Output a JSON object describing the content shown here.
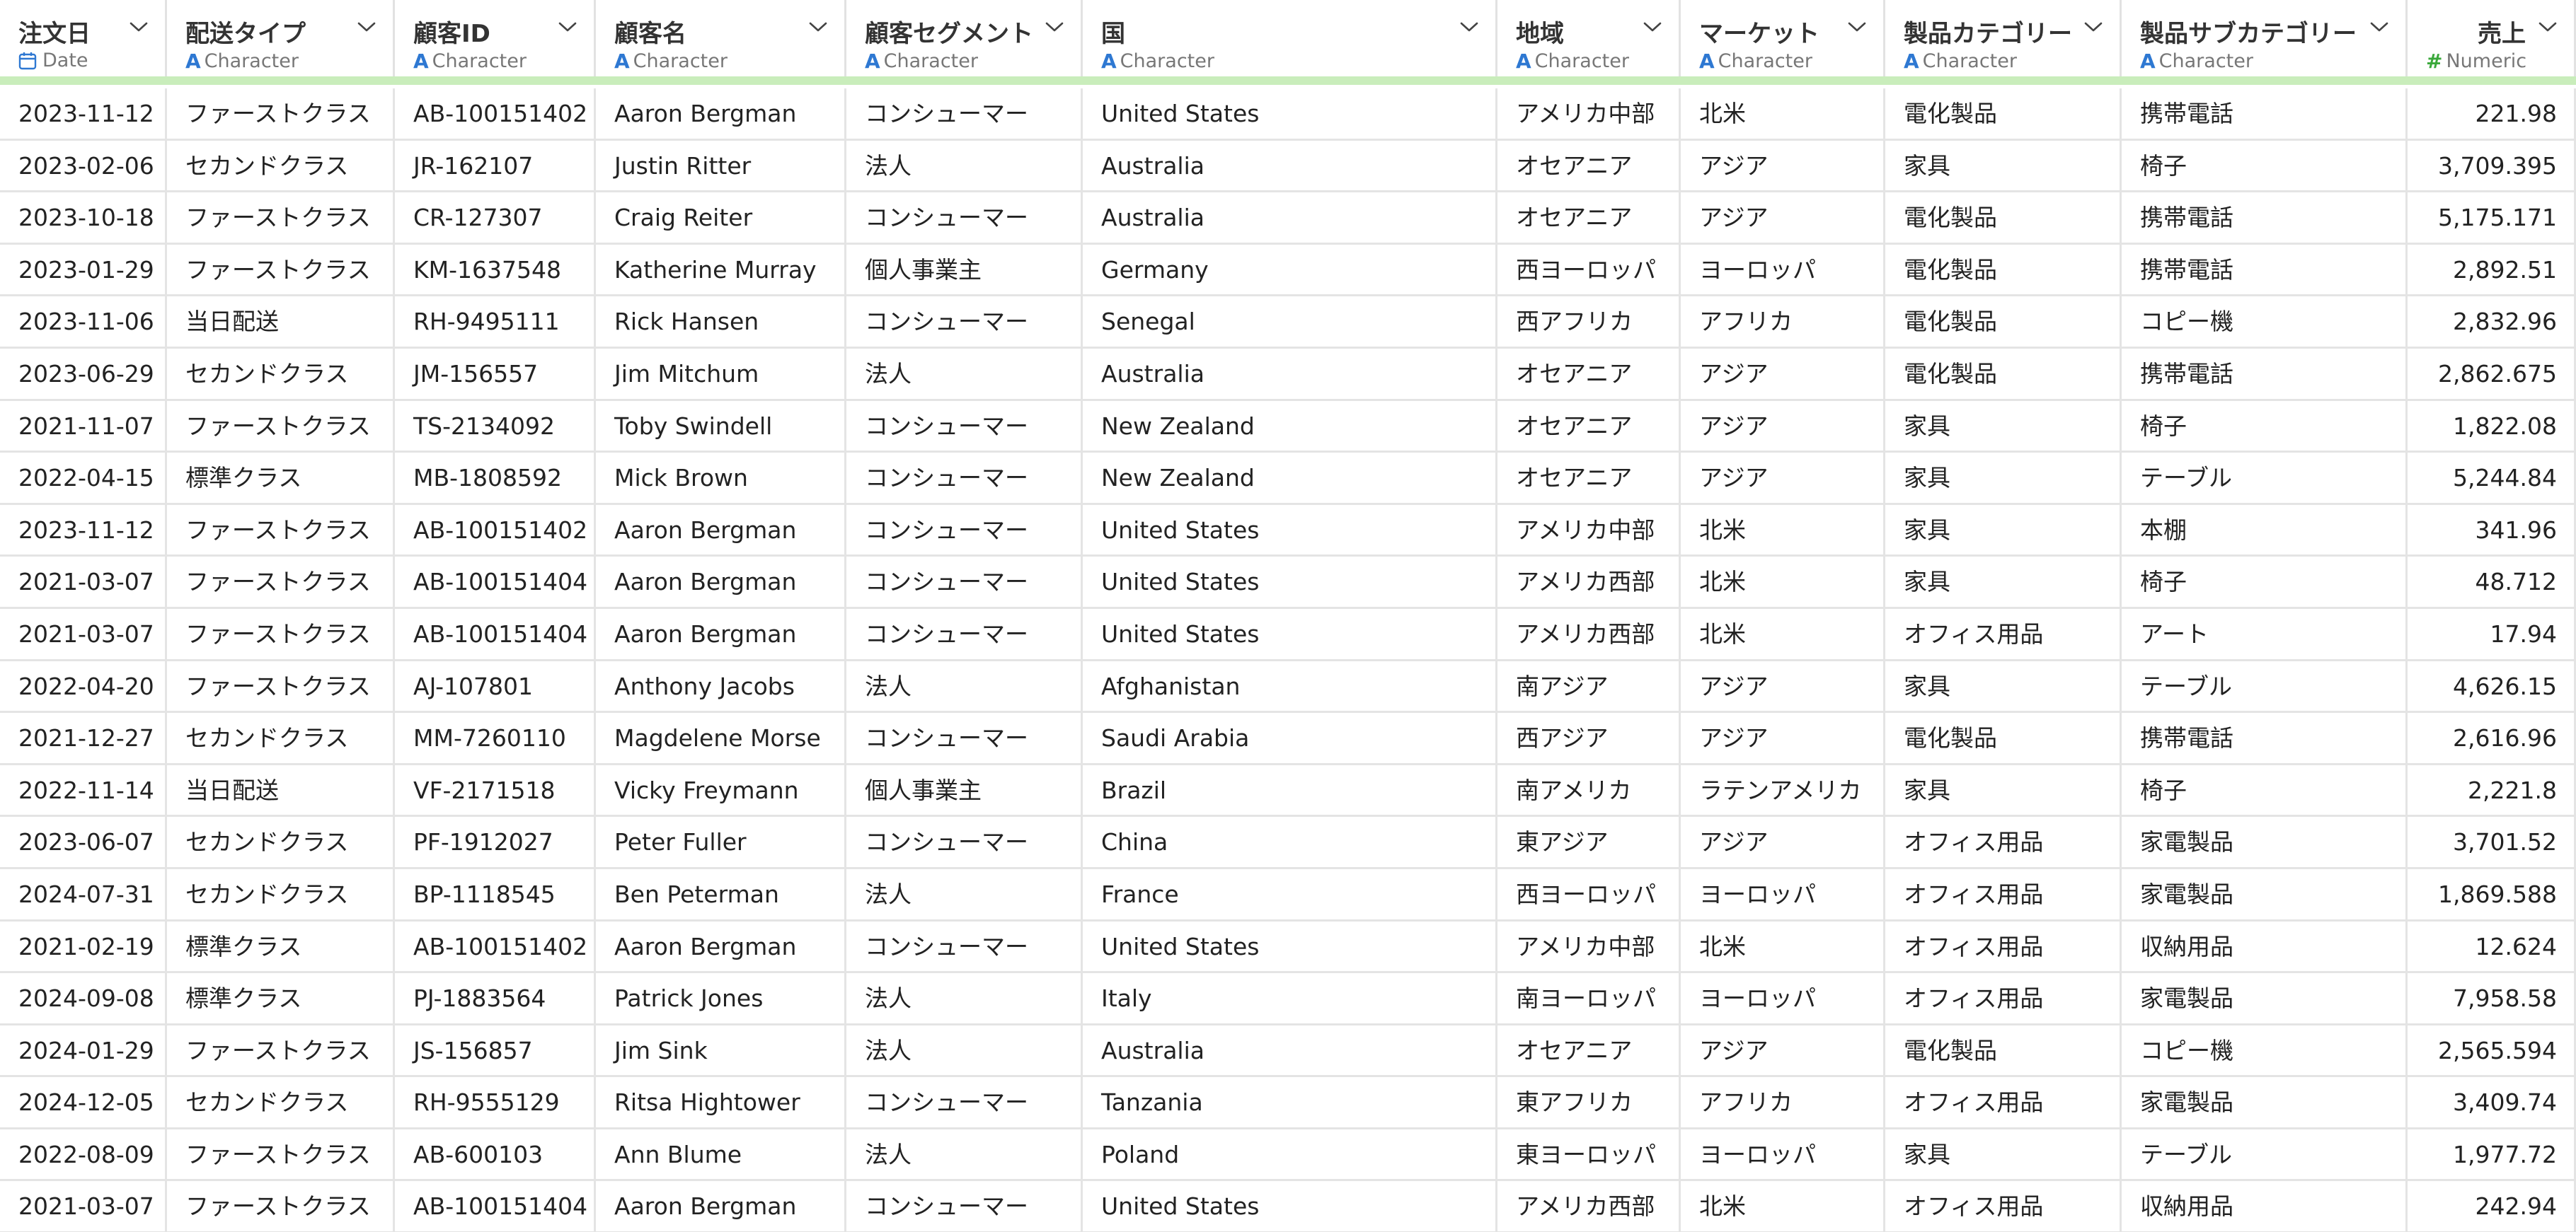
{
  "columns": [
    {
      "name": "注文日",
      "type": "Date",
      "type_icon": "calendar-icon",
      "align": "left"
    },
    {
      "name": "配送タイプ",
      "type": "Character",
      "type_icon": "character-icon",
      "align": "left"
    },
    {
      "name": "顧客ID",
      "type": "Character",
      "type_icon": "character-icon",
      "align": "left"
    },
    {
      "name": "顧客名",
      "type": "Character",
      "type_icon": "character-icon",
      "align": "left"
    },
    {
      "name": "顧客セグメント",
      "type": "Character",
      "type_icon": "character-icon",
      "align": "left"
    },
    {
      "name": "国",
      "type": "Character",
      "type_icon": "character-icon",
      "align": "left"
    },
    {
      "name": "地域",
      "type": "Character",
      "type_icon": "character-icon",
      "align": "left"
    },
    {
      "name": "マーケット",
      "type": "Character",
      "type_icon": "character-icon",
      "align": "left"
    },
    {
      "name": "製品カテゴリー",
      "type": "Character",
      "type_icon": "character-icon",
      "align": "left"
    },
    {
      "name": "製品サブカテゴリー",
      "type": "Character",
      "type_icon": "character-icon",
      "align": "left"
    },
    {
      "name": "売上",
      "type": "Numeric",
      "type_icon": "numeric-icon",
      "align": "right"
    }
  ],
  "type_icon_glyphs": {
    "character": "A",
    "numeric": "#"
  },
  "colors": {
    "character": "#2e78d2",
    "numeric": "#39a83a",
    "date": "#2e78d2",
    "header_bar": "#c9edbb"
  },
  "rows": [
    [
      "2023-11-12",
      "ファーストクラス",
      "AB-100151402",
      "Aaron Bergman",
      "コンシューマー",
      "United States",
      "アメリカ中部",
      "北米",
      "電化製品",
      "携帯電話",
      "221.98"
    ],
    [
      "2023-02-06",
      "セカンドクラス",
      "JR-162107",
      "Justin Ritter",
      "法人",
      "Australia",
      "オセアニア",
      "アジア",
      "家具",
      "椅子",
      "3,709.395"
    ],
    [
      "2023-10-18",
      "ファーストクラス",
      "CR-127307",
      "Craig Reiter",
      "コンシューマー",
      "Australia",
      "オセアニア",
      "アジア",
      "電化製品",
      "携帯電話",
      "5,175.171"
    ],
    [
      "2023-01-29",
      "ファーストクラス",
      "KM-1637548",
      "Katherine Murray",
      "個人事業主",
      "Germany",
      "西ヨーロッパ",
      "ヨーロッパ",
      "電化製品",
      "携帯電話",
      "2,892.51"
    ],
    [
      "2023-11-06",
      "当日配送",
      "RH-9495111",
      "Rick Hansen",
      "コンシューマー",
      "Senegal",
      "西アフリカ",
      "アフリカ",
      "電化製品",
      "コピー機",
      "2,832.96"
    ],
    [
      "2023-06-29",
      "セカンドクラス",
      "JM-156557",
      "Jim Mitchum",
      "法人",
      "Australia",
      "オセアニア",
      "アジア",
      "電化製品",
      "携帯電話",
      "2,862.675"
    ],
    [
      "2021-11-07",
      "ファーストクラス",
      "TS-2134092",
      "Toby Swindell",
      "コンシューマー",
      "New Zealand",
      "オセアニア",
      "アジア",
      "家具",
      "椅子",
      "1,822.08"
    ],
    [
      "2022-04-15",
      "標準クラス",
      "MB-1808592",
      "Mick Brown",
      "コンシューマー",
      "New Zealand",
      "オセアニア",
      "アジア",
      "家具",
      "テーブル",
      "5,244.84"
    ],
    [
      "2023-11-12",
      "ファーストクラス",
      "AB-100151402",
      "Aaron Bergman",
      "コンシューマー",
      "United States",
      "アメリカ中部",
      "北米",
      "家具",
      "本棚",
      "341.96"
    ],
    [
      "2021-03-07",
      "ファーストクラス",
      "AB-100151404",
      "Aaron Bergman",
      "コンシューマー",
      "United States",
      "アメリカ西部",
      "北米",
      "家具",
      "椅子",
      "48.712"
    ],
    [
      "2021-03-07",
      "ファーストクラス",
      "AB-100151404",
      "Aaron Bergman",
      "コンシューマー",
      "United States",
      "アメリカ西部",
      "北米",
      "オフィス用品",
      "アート",
      "17.94"
    ],
    [
      "2022-04-20",
      "ファーストクラス",
      "AJ-107801",
      "Anthony Jacobs",
      "法人",
      "Afghanistan",
      "南アジア",
      "アジア",
      "家具",
      "テーブル",
      "4,626.15"
    ],
    [
      "2021-12-27",
      "セカンドクラス",
      "MM-7260110",
      "Magdelene Morse",
      "コンシューマー",
      "Saudi Arabia",
      "西アジア",
      "アジア",
      "電化製品",
      "携帯電話",
      "2,616.96"
    ],
    [
      "2022-11-14",
      "当日配送",
      "VF-2171518",
      "Vicky Freymann",
      "個人事業主",
      "Brazil",
      "南アメリカ",
      "ラテンアメリカ",
      "家具",
      "椅子",
      "2,221.8"
    ],
    [
      "2023-06-07",
      "セカンドクラス",
      "PF-1912027",
      "Peter Fuller",
      "コンシューマー",
      "China",
      "東アジア",
      "アジア",
      "オフィス用品",
      "家電製品",
      "3,701.52"
    ],
    [
      "2024-07-31",
      "セカンドクラス",
      "BP-1118545",
      "Ben Peterman",
      "法人",
      "France",
      "西ヨーロッパ",
      "ヨーロッパ",
      "オフィス用品",
      "家電製品",
      "1,869.588"
    ],
    [
      "2021-02-19",
      "標準クラス",
      "AB-100151402",
      "Aaron Bergman",
      "コンシューマー",
      "United States",
      "アメリカ中部",
      "北米",
      "オフィス用品",
      "収納用品",
      "12.624"
    ],
    [
      "2024-09-08",
      "標準クラス",
      "PJ-1883564",
      "Patrick Jones",
      "法人",
      "Italy",
      "南ヨーロッパ",
      "ヨーロッパ",
      "オフィス用品",
      "家電製品",
      "7,958.58"
    ],
    [
      "2024-01-29",
      "ファーストクラス",
      "JS-156857",
      "Jim Sink",
      "法人",
      "Australia",
      "オセアニア",
      "アジア",
      "電化製品",
      "コピー機",
      "2,565.594"
    ],
    [
      "2024-12-05",
      "セカンドクラス",
      "RH-9555129",
      "Ritsa Hightower",
      "コンシューマー",
      "Tanzania",
      "東アフリカ",
      "アフリカ",
      "オフィス用品",
      "家電製品",
      "3,409.74"
    ],
    [
      "2022-08-09",
      "ファーストクラス",
      "AB-600103",
      "Ann Blume",
      "法人",
      "Poland",
      "東ヨーロッパ",
      "ヨーロッパ",
      "家具",
      "テーブル",
      "1,977.72"
    ],
    [
      "2021-03-07",
      "ファーストクラス",
      "AB-100151404",
      "Aaron Bergman",
      "コンシューマー",
      "United States",
      "アメリカ西部",
      "北米",
      "オフィス用品",
      "収納用品",
      "242.94"
    ]
  ]
}
